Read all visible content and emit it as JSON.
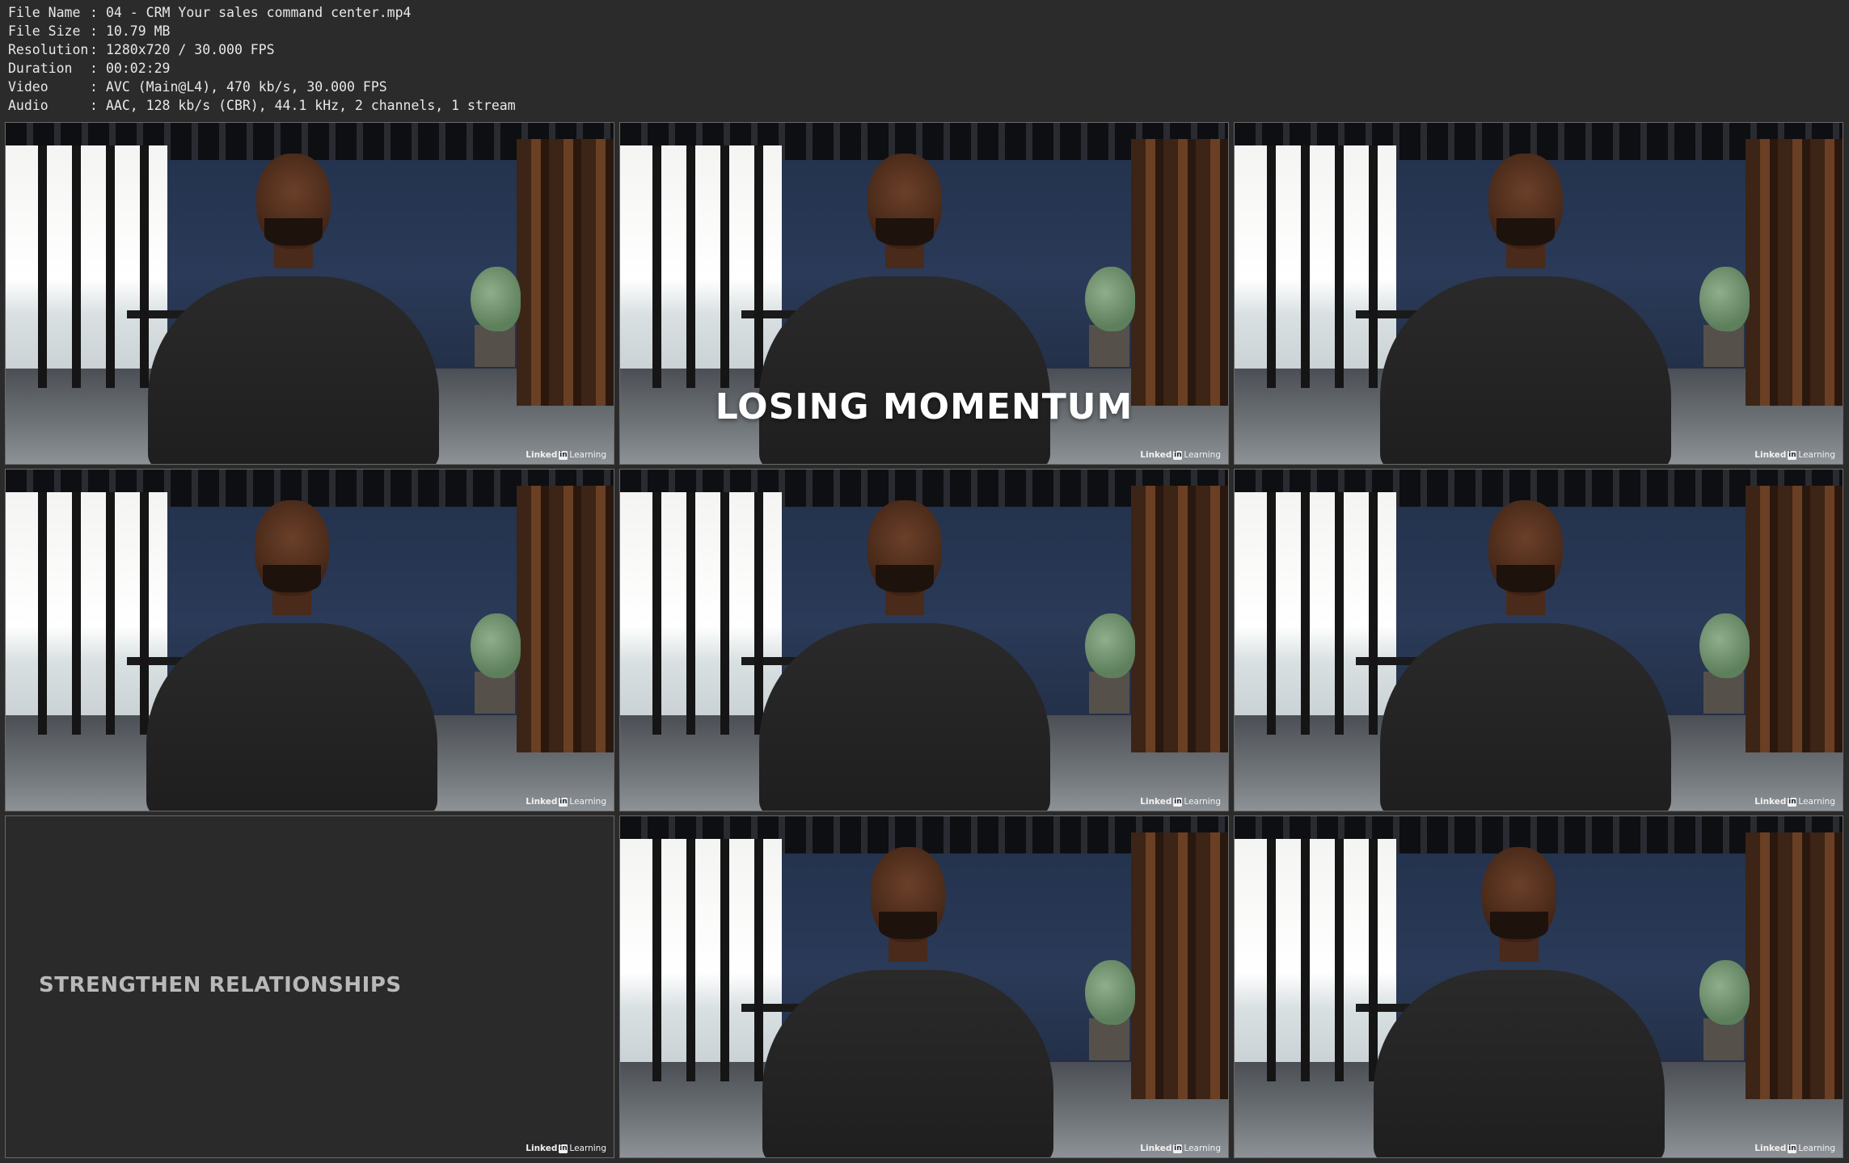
{
  "metadata": [
    {
      "key": "File Name",
      "sep": ":",
      "value": "04 - CRM Your sales command center.mp4"
    },
    {
      "key": "File Size",
      "sep": ":",
      "value": "10.79 MB"
    },
    {
      "key": "Resolution",
      "sep": ":",
      "value": "1280x720 / 30.000 FPS"
    },
    {
      "key": "Duration",
      "sep": ":",
      "value": "00:02:29"
    },
    {
      "key": "Video",
      "sep": ":",
      "value": "AVC (Main@L4), 470 kb/s, 30.000 FPS"
    },
    {
      "key": "Audio",
      "sep": ":",
      "value": "AAC, 128 kb/s (CBR), 44.1 kHz, 2 channels, 1 stream"
    }
  ],
  "watermark": {
    "brand": "Linked",
    "in": "in",
    "word": "Learning"
  },
  "frames": [
    {
      "type": "video",
      "overlay": ""
    },
    {
      "type": "video",
      "overlay": "LOSING MOMENTUM"
    },
    {
      "type": "video",
      "overlay": ""
    },
    {
      "type": "video",
      "overlay": ""
    },
    {
      "type": "video",
      "overlay": ""
    },
    {
      "type": "video",
      "overlay": ""
    },
    {
      "type": "title",
      "overlay": "STRENGTHEN RELATIONSHIPS"
    },
    {
      "type": "video",
      "overlay": ""
    },
    {
      "type": "video",
      "overlay": ""
    }
  ]
}
